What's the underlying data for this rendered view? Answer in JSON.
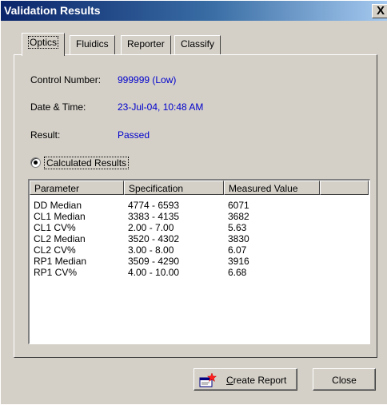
{
  "window": {
    "title": "Validation Results",
    "close_glyph": "X"
  },
  "tabs": [
    {
      "label": "Optics",
      "active": true
    },
    {
      "label": "Fluidics",
      "active": false
    },
    {
      "label": "Reporter",
      "active": false
    },
    {
      "label": "Classify",
      "active": false
    }
  ],
  "info": {
    "control_number_label": "Control Number:",
    "control_number_value": "999999 (Low)",
    "datetime_label": "Date & Time:",
    "datetime_value": "23-Jul-04, 10:48 AM",
    "result_label": "Result:",
    "result_value": "Passed"
  },
  "radio": {
    "label": "Calculated Results",
    "checked": true
  },
  "table": {
    "columns": [
      "Parameter",
      "Specification",
      "Measured Value",
      ""
    ],
    "rows": [
      [
        "DD Median",
        "4774 - 6593",
        "6071"
      ],
      [
        "CL1 Median",
        "3383 - 4135",
        "3682"
      ],
      [
        "CL1 CV%",
        "2.00 - 7.00",
        "5.63"
      ],
      [
        "CL2 Median",
        "3520 - 4302",
        "3830"
      ],
      [
        "CL2 CV%",
        "3.00 - 8.00",
        "6.07"
      ],
      [
        "RP1 Median",
        "3509 - 4290",
        "3916"
      ],
      [
        "RP1 CV%",
        "4.00 - 10.00",
        "6.68"
      ]
    ]
  },
  "buttons": {
    "create_report_mnemonic": "C",
    "create_report_rest": "reate Report",
    "close": "Close"
  },
  "colors": {
    "title_start": "#0a246a",
    "title_end": "#a6caf0",
    "value_text": "#0000cc",
    "face": "#d4d0c8"
  },
  "icons": {
    "create_report": "report-star-icon"
  }
}
